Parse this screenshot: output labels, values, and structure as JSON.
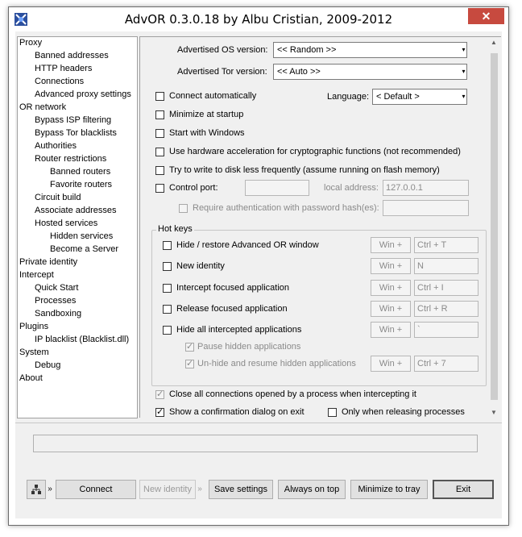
{
  "window": {
    "title": "AdvOR  0.3.0.18 by Albu Cristian, 2009-2012",
    "close_glyph": "✕"
  },
  "tree": {
    "items": [
      {
        "label": "Proxy",
        "level": 0
      },
      {
        "label": "Banned addresses",
        "level": 1
      },
      {
        "label": "HTTP headers",
        "level": 1
      },
      {
        "label": "Connections",
        "level": 1
      },
      {
        "label": "Advanced proxy settings",
        "level": 1
      },
      {
        "label": "OR network",
        "level": 0
      },
      {
        "label": "Bypass ISP filtering",
        "level": 1
      },
      {
        "label": "Bypass Tor blacklists",
        "level": 1
      },
      {
        "label": "Authorities",
        "level": 1
      },
      {
        "label": "Router restrictions",
        "level": 1
      },
      {
        "label": "Banned routers",
        "level": 2
      },
      {
        "label": "Favorite routers",
        "level": 2
      },
      {
        "label": "Circuit build",
        "level": 1
      },
      {
        "label": "Associate addresses",
        "level": 1
      },
      {
        "label": "Hosted services",
        "level": 1
      },
      {
        "label": "Hidden services",
        "level": 2
      },
      {
        "label": "Become a Server",
        "level": 2
      },
      {
        "label": "Private identity",
        "level": 0
      },
      {
        "label": "Intercept",
        "level": 0
      },
      {
        "label": "Quick Start",
        "level": 1
      },
      {
        "label": "Processes",
        "level": 1
      },
      {
        "label": "Sandboxing",
        "level": 1
      },
      {
        "label": "Plugins",
        "level": 0
      },
      {
        "label": "IP blacklist (Blacklist.dll)",
        "level": 1
      },
      {
        "label": "System",
        "level": 0
      },
      {
        "label": "Debug",
        "level": 1
      },
      {
        "label": "About",
        "level": 0
      }
    ]
  },
  "settings": {
    "os_version_label": "Advertised OS version:",
    "os_version_value": "<< Random >>",
    "tor_version_label": "Advertised Tor version:",
    "tor_version_value": "<< Auto >>",
    "connect_auto": "Connect automatically",
    "language_label": "Language:",
    "language_value": "< Default >",
    "minimize_startup": "Minimize at startup",
    "start_windows": "Start with Windows",
    "hw_accel": "Use hardware acceleration for cryptographic functions (not recommended)",
    "disk_less": "Try to write to disk less frequently (assume running on flash memory)",
    "control_port": "Control port:",
    "local_address_label": "local address:",
    "local_address_value": "127.0.0.1",
    "require_auth": "Require authentication with password hash(es):",
    "hotkeys_title": "Hot keys",
    "hk_hide": "Hide / restore Advanced OR window",
    "hk_new_identity": "New identity",
    "hk_intercept": "Intercept focused application",
    "hk_release": "Release focused application",
    "hk_hide_all": "Hide all intercepted applications",
    "hk_pause_hidden": "Pause hidden applications",
    "hk_unhide": "Un-hide and resume hidden applications",
    "mod_win": "Win +",
    "key_hide": "Ctrl + T",
    "key_new_identity": "N",
    "key_intercept": "Ctrl + I",
    "key_release": "Ctrl + R",
    "key_hide_all": "`",
    "key_unhide": "Ctrl + 7",
    "close_conn": "Close all connections opened by a process when intercepting it",
    "show_confirm": "Show a confirmation dialog on exit",
    "only_release": "Only when releasing processes",
    "check_glyph": "✓"
  },
  "bottom": {
    "connect": "Connect",
    "new_identity": "New identity",
    "save_settings": "Save settings",
    "always_on_top": "Always on top",
    "minimize_tray": "Minimize to tray",
    "exit": "Exit",
    "more_glyph": "»"
  }
}
